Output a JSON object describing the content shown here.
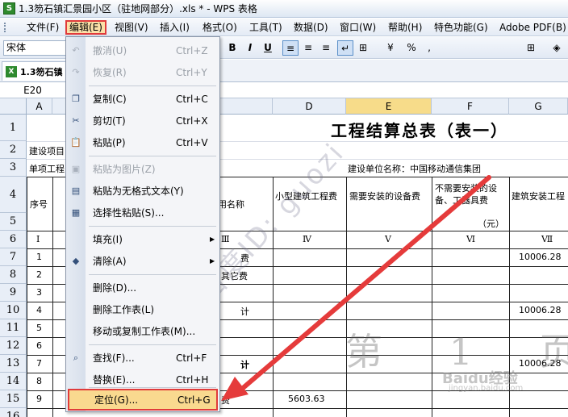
{
  "window": {
    "title": "1.3笏石镇汇景园小区（驻地网部分）.xls * - WPS 表格",
    "logo_letter": "S"
  },
  "menubar": {
    "items": [
      "文件(F)",
      "编辑(E)",
      "视图(V)",
      "插入(I)",
      "格式(O)",
      "工具(T)",
      "数据(D)",
      "窗口(W)",
      "帮助(H)",
      "特色功能(G)",
      "Adobe PDF(B)"
    ],
    "active_index": 1
  },
  "toolbar": {
    "font_name": "宋体",
    "bold": "B",
    "italic": "I",
    "underline": "U",
    "percent": "%",
    "currency": "¥",
    "comma": ","
  },
  "tabbar": {
    "doc_tab": "1.3笏石镇"
  },
  "formula": {
    "cell_ref": "E20"
  },
  "grid": {
    "col_headers": [
      "A",
      "B",
      "C",
      "D",
      "E",
      "F",
      "G"
    ],
    "highlight_col": "E",
    "row_headers": [
      "1",
      "2",
      "3",
      "4",
      "5",
      "6",
      "7",
      "8",
      "9",
      "10",
      "11",
      "12",
      "13",
      "14",
      "15",
      "16"
    ],
    "title": "工程结算总表（表一）",
    "a2": "建设项目",
    "a3": "单项工程",
    "owner_unit": "建设单位名称：中国移动通信集团",
    "seq_header": "序号",
    "name_header": "用名称",
    "d4": "小型建筑工程费",
    "e4": "需要安装的设备费",
    "f4": "不需要安装的设备、工器具费",
    "g4": "建筑安装工程",
    "unit": "（元）",
    "roman_a": "Ⅰ",
    "roman_c": "Ⅲ",
    "roman_d": "Ⅳ",
    "roman_e": "Ⅴ",
    "roman_f": "Ⅵ",
    "roman_g": "Ⅶ",
    "seq": [
      "1",
      "2",
      "3",
      "4",
      "5",
      "6",
      "7",
      "8",
      "9"
    ],
    "c7": "费",
    "c8": "其它费",
    "c10": "计",
    "c13": "计",
    "c15": "费",
    "g7": "10006.28",
    "g10": "10006.28",
    "g13": "10006.28",
    "d15": "5603.63",
    "watermark": "百度ID: guozi",
    "page_mark": "第 1 页",
    "baidu_logo": "Baidu经验",
    "baidu_url": "jingyan.baidu.com"
  },
  "dropdown": {
    "items": [
      {
        "label": "撤消(U)",
        "shortcut": "Ctrl+Z",
        "icon": "undo-icon",
        "glyph": "↶",
        "disabled": true
      },
      {
        "label": "恢复(R)",
        "shortcut": "Ctrl+Y",
        "icon": "redo-icon",
        "glyph": "↷",
        "disabled": true
      },
      {
        "label": "复制(C)",
        "shortcut": "Ctrl+C",
        "icon": "copy-icon",
        "glyph": "❐",
        "disabled": false
      },
      {
        "label": "剪切(T)",
        "shortcut": "Ctrl+X",
        "icon": "scissors-icon",
        "glyph": "✂",
        "disabled": false
      },
      {
        "label": "粘贴(P)",
        "shortcut": "Ctrl+V",
        "icon": "paste-icon",
        "glyph": "📋",
        "disabled": false
      },
      {
        "label": "粘贴为图片(Z)",
        "shortcut": "",
        "icon": "paste-picture-icon",
        "glyph": "▣",
        "disabled": true
      },
      {
        "label": "粘贴为无格式文本(Y)",
        "shortcut": "",
        "icon": "paste-text-icon",
        "glyph": "▤",
        "disabled": false
      },
      {
        "label": "选择性粘贴(S)...",
        "shortcut": "",
        "icon": "paste-special-icon",
        "glyph": "▦",
        "disabled": false
      },
      {
        "label": "填充(I)",
        "shortcut": "",
        "icon": "",
        "glyph": "",
        "disabled": false,
        "submenu": true
      },
      {
        "label": "清除(A)",
        "shortcut": "",
        "icon": "eraser-icon",
        "glyph": "◆",
        "disabled": false,
        "submenu": true
      },
      {
        "label": "删除(D)...",
        "shortcut": "",
        "icon": "",
        "glyph": "",
        "disabled": false
      },
      {
        "label": "删除工作表(L)",
        "shortcut": "",
        "icon": "",
        "glyph": "",
        "disabled": false
      },
      {
        "label": "移动或复制工作表(M)...",
        "shortcut": "",
        "icon": "",
        "glyph": "",
        "disabled": false
      },
      {
        "label": "查找(F)...",
        "shortcut": "Ctrl+F",
        "icon": "binoculars-icon",
        "glyph": "⌕",
        "disabled": false
      },
      {
        "label": "替换(E)...",
        "shortcut": "Ctrl+H",
        "icon": "",
        "glyph": "",
        "disabled": false
      },
      {
        "label": "定位(G)...",
        "shortcut": "Ctrl+G",
        "icon": "",
        "glyph": "",
        "disabled": false,
        "focused": true
      }
    ],
    "submenu_glyph": "▶"
  },
  "colors": {
    "highlight_border": "#e03b3b",
    "menu_highlight": "#f9d98f",
    "arrow": "#e53b3b"
  }
}
